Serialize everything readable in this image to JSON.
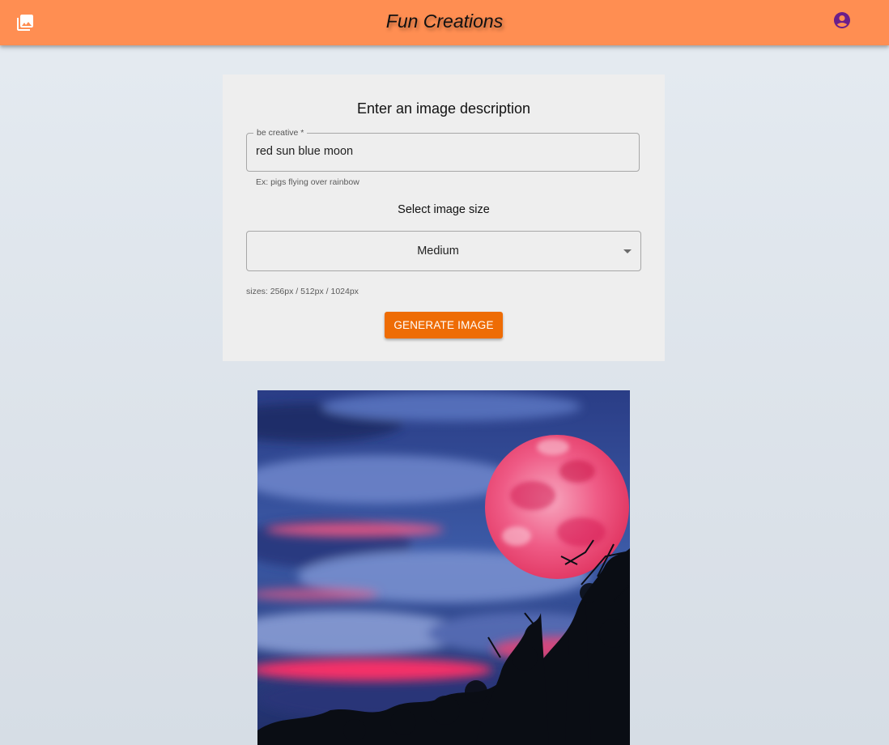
{
  "appbar": {
    "title": "Fun Creations",
    "gallery_icon": "photo-library-icon",
    "account_icon": "account-circle-icon",
    "background_color": "#ff8e52",
    "account_icon_color": "#6b1f8a"
  },
  "form": {
    "heading": "Enter an image description",
    "description_field": {
      "label": "be creative *",
      "value": "red sun blue moon",
      "helper": "Ex: pigs flying over rainbow"
    },
    "size_label": "Select image size",
    "size_select": {
      "value": "Medium"
    },
    "sizes_hint": "sizes: 256px / 512px / 1024px",
    "generate_button": "GENERATE IMAGE",
    "button_color": "#ee6c05"
  },
  "result": {
    "image": "generated-image",
    "colors": {
      "sky": "#2c3f83",
      "moon": "#ee4f7c",
      "glow": "#ff3f6e",
      "trees": "#0a0d14"
    }
  }
}
